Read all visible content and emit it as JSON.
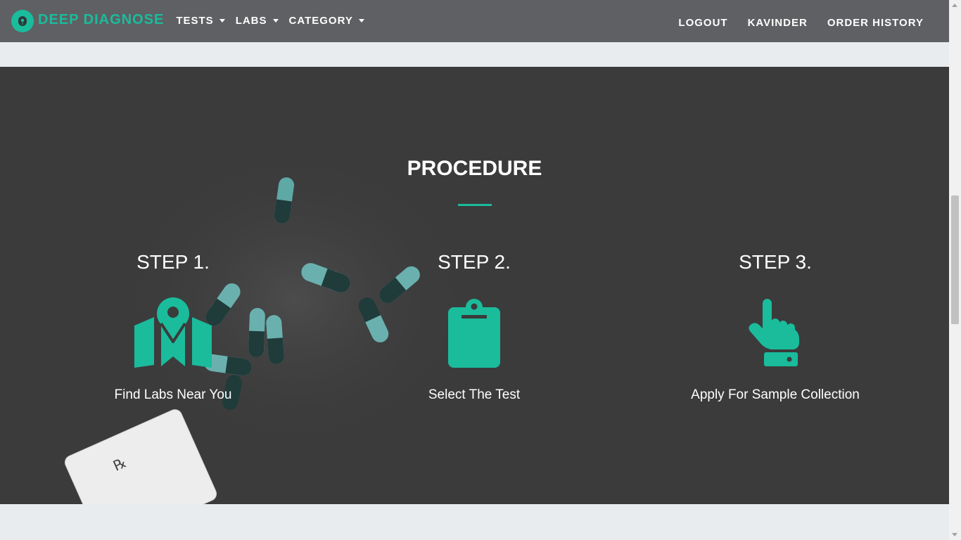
{
  "navbar": {
    "brand": "DEEP DIAGNOSE",
    "menu": [
      {
        "label": "TESTS"
      },
      {
        "label": "LABS"
      },
      {
        "label": "CATEGORY"
      }
    ],
    "right": [
      {
        "label": "LOGOUT"
      },
      {
        "label": "KAVINDER"
      },
      {
        "label": "ORDER HISTORY"
      }
    ]
  },
  "procedure": {
    "title": "PROCEDURE",
    "steps": [
      {
        "title": "STEP 1.",
        "icon": "map-marker-icon",
        "text": "Find Labs Near You"
      },
      {
        "title": "STEP 2.",
        "icon": "clipboard-icon",
        "text": "Select The Test"
      },
      {
        "title": "STEP 3.",
        "icon": "hand-pointer-icon",
        "text": "Apply For Sample Collection"
      }
    ]
  },
  "colors": {
    "accent": "#1abc9c",
    "navbar_bg": "#5f6063",
    "section_bg": "#3b3b3b",
    "page_bg": "#e9ecef"
  }
}
